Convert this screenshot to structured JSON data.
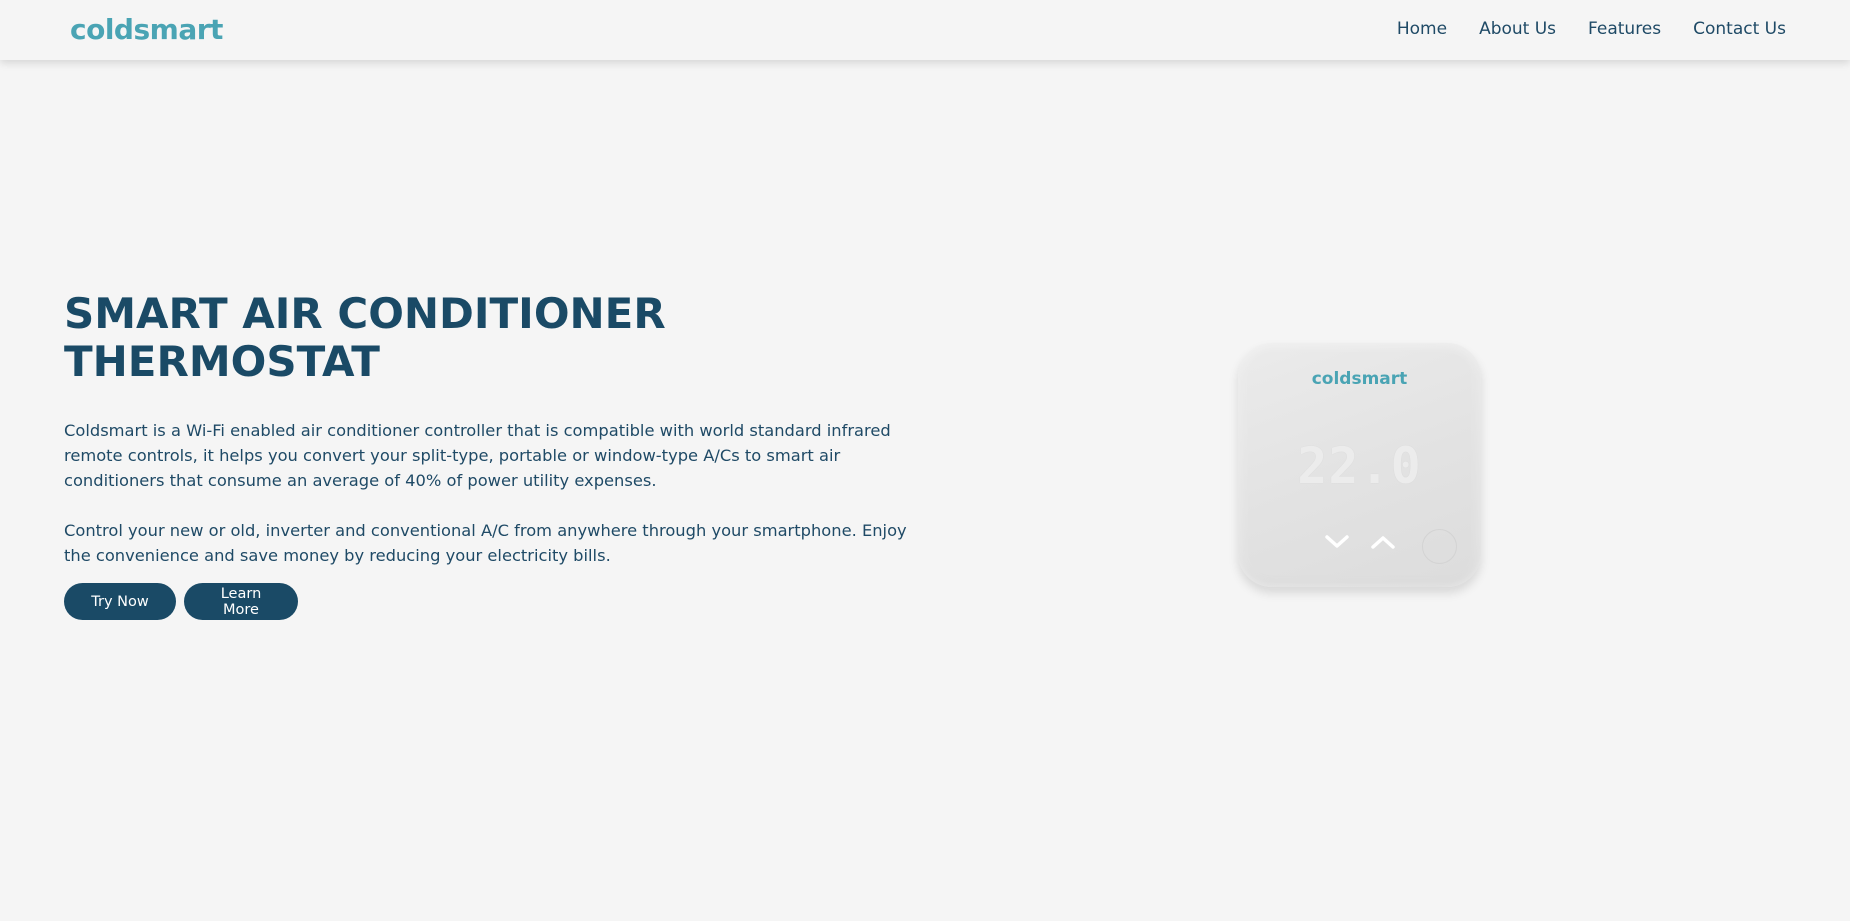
{
  "header": {
    "logo": "coldsmart",
    "nav": [
      "Home",
      "About Us",
      "Features",
      "Contact Us"
    ]
  },
  "hero": {
    "title_line1": "SMART AIR CONDITIONER",
    "title_line2": "THERMOSTAT",
    "paragraph1": "Coldsmart is a Wi-Fi enabled air conditioner controller that is compatible with world standard infrared remote controls, it helps you convert your split-type, portable or window-type A/Cs to smart air conditioners that consume an average of 40% of power utility expenses.",
    "paragraph2": "Control your new or old, inverter and conventional A/C from anywhere through your smartphone. Enjoy the convenience and save money by reducing your electricity bills.",
    "buttons": {
      "primary": "Try Now",
      "secondary": "Learn More"
    }
  },
  "device": {
    "brand": "coldsmart",
    "temperature": "22.0",
    "icons": [
      "chevron-down-icon",
      "chevron-up-icon"
    ]
  },
  "colors": {
    "background": "#f5f5f5",
    "primary": "#1a4a66",
    "brand": "#4aa4b4",
    "button_text": "#ffffff"
  }
}
